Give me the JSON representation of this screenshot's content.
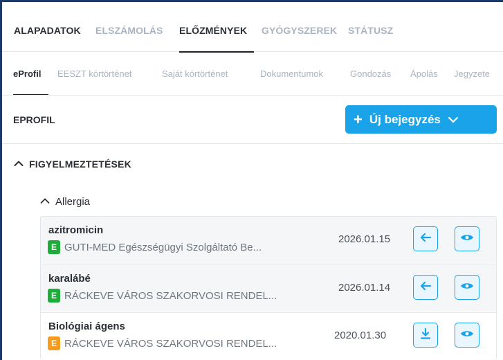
{
  "main_tabs": [
    {
      "label": "ALAPADATOK",
      "state": "normal"
    },
    {
      "label": "ELSZÁMOLÁS",
      "state": "muted"
    },
    {
      "label": "ELŐZMÉNYEK",
      "state": "active"
    },
    {
      "label": "GYÓGYSZEREK",
      "state": "muted"
    },
    {
      "label": "STÁTUSZ",
      "state": "muted"
    }
  ],
  "sub_tabs": [
    {
      "label": "eProfil",
      "state": "active"
    },
    {
      "label": "EESZT kórtörténet",
      "state": "muted"
    },
    {
      "label": "Saját kórtörténet",
      "state": "muted"
    },
    {
      "label": "Dokumentumok",
      "state": "muted"
    },
    {
      "label": "Gondozás",
      "state": "muted"
    },
    {
      "label": "Ápolás",
      "state": "muted"
    },
    {
      "label": "Jegyzete",
      "state": "muted"
    }
  ],
  "section": {
    "title": "EPROFIL",
    "new_button": {
      "label": "Új bejegyzés",
      "icon": "plus-icon",
      "dropdown_icon": "chevron-down-icon"
    }
  },
  "group": {
    "label": "FIGYELMEZTETÉSEK",
    "icon": "chevron-up-icon"
  },
  "sub_group": {
    "label": "Allergia",
    "icon": "chevron-up-icon"
  },
  "rows": [
    {
      "title": "azitromicin",
      "badge": "E",
      "badge_color": "#1fad3a",
      "provider": "GUTI-MED Egészségügyi Szolgáltató Be...",
      "date": "2026.01.15",
      "action_icon": "arrow-left-icon",
      "view_icon": "eye-icon"
    },
    {
      "title": "karalábé",
      "badge": "E",
      "badge_color": "#1fad3a",
      "provider": "RÁCKEVE VÁROS SZAKORVOSI RENDEL...",
      "date": "2026.01.14",
      "action_icon": "arrow-left-icon",
      "view_icon": "eye-icon"
    },
    {
      "title": "Biológiai ágens",
      "badge": "E",
      "badge_color": "#f39c1f",
      "provider": "RÁCKEVE VÁROS SZAKORVOSI RENDEL...",
      "date": "2020.01.30",
      "action_icon": "download-icon",
      "view_icon": "eye-icon"
    }
  ],
  "colors": {
    "accent": "#1aa3e8",
    "frame": "#1b3a66",
    "badge_green": "#1fad3a",
    "badge_orange": "#f39c1f"
  }
}
